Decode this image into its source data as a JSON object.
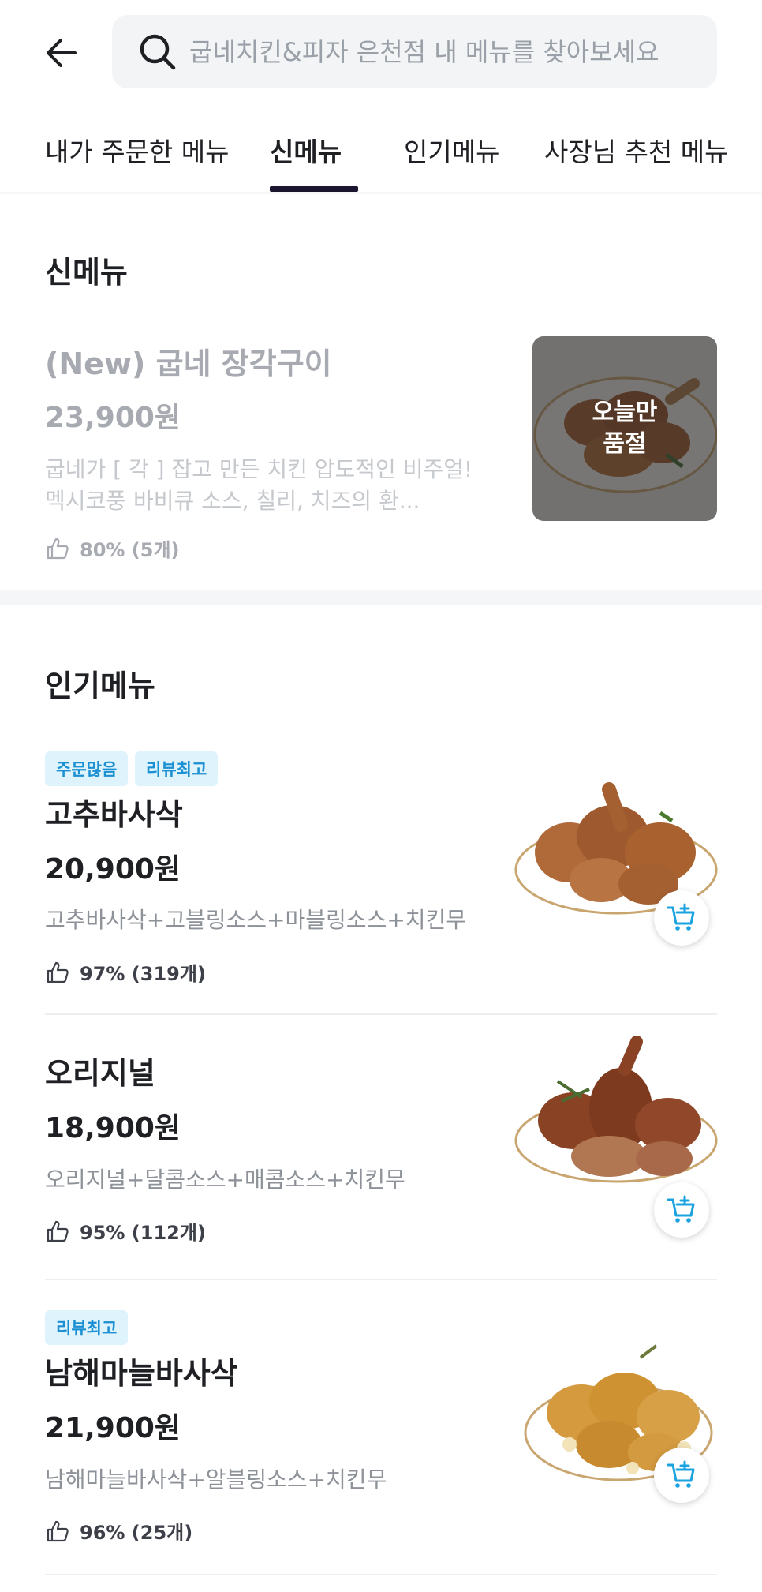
{
  "header": {
    "search_placeholder": "굽네치킨&피자 은천점 내 메뉴를 찾아보세요"
  },
  "tabs": [
    {
      "label": "내가 주문한 메뉴",
      "active": false
    },
    {
      "label": "신메뉴",
      "active": true
    },
    {
      "label": "인기메뉴",
      "active": false
    },
    {
      "label": "사장님 추천 메뉴",
      "active": false
    }
  ],
  "new_menu": {
    "title": "신메뉴",
    "item": {
      "name": "(New) 굽네 장각구이",
      "price": "23,900원",
      "description": "굽네가 [ 각 ] 잡고 만든 치킨 압도적인 비주얼! 멕시코풍 바비큐 소스, 칠리, 치즈의 환...",
      "rating": "80% (5개)",
      "status": "오늘만\n품절"
    }
  },
  "popular_menu": {
    "title": "인기메뉴",
    "items": [
      {
        "badges": [
          "주문많음",
          "리뷰최고"
        ],
        "name": "고추바사삭",
        "price": "20,900원",
        "description": "고추바사삭+고블링소스+마블링소스+치킨무",
        "rating": "97% (319개)"
      },
      {
        "badges": [],
        "name": "오리지널",
        "price": "18,900원",
        "description": "오리지널+달콤소스+매콤소스+치킨무",
        "rating": "95% (112개)"
      },
      {
        "badges": [
          "리뷰최고"
        ],
        "name": "남해마늘바사삭",
        "price": "21,900원",
        "description": "남해마늘바사삭+알블링소스+치킨무",
        "rating": "96% (25개)"
      }
    ]
  },
  "colors": {
    "accent": "#1c1530",
    "badge_bg": "#dff3fc",
    "badge_text": "#1a8fd1",
    "cart_icon": "#1aa3e0"
  },
  "icons": {
    "back": "arrow-left-icon",
    "search": "search-icon",
    "like": "thumbs-up-icon",
    "cart": "cart-plus-icon"
  }
}
